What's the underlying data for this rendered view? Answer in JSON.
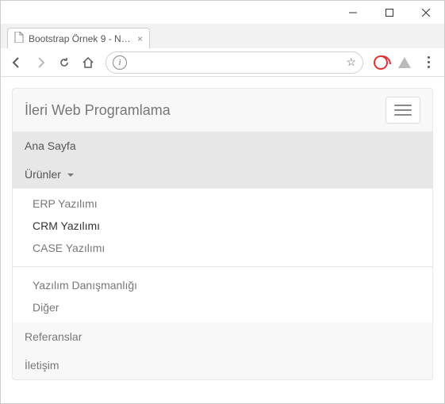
{
  "window": {
    "tab_title": "Bootstrap Örnek 9 - Nav",
    "url": ""
  },
  "navbar": {
    "brand": "İleri Web Programlama"
  },
  "nav": {
    "home": "Ana Sayfa",
    "products": "Ürünler",
    "references": "Referanslar",
    "contact": "İletişim"
  },
  "dropdown": {
    "erp": "ERP Yazılımı",
    "crm": "CRM Yazılımı",
    "case": "CASE Yazılımı",
    "consulting": "Yazılım Danışmanlığı",
    "other": "Diğer"
  }
}
